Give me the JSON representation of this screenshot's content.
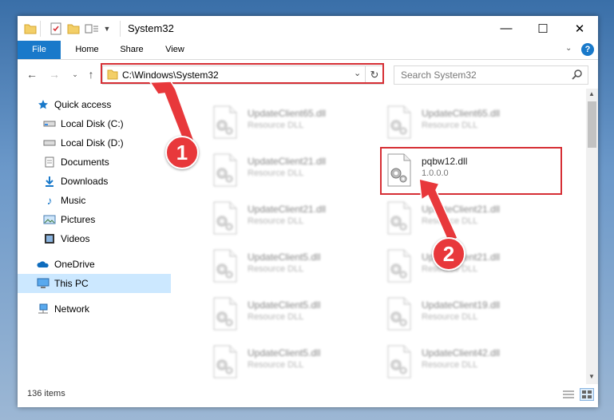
{
  "window": {
    "title": "System32"
  },
  "ribbon": {
    "tabs": [
      "File",
      "Home",
      "Share",
      "View"
    ]
  },
  "address": {
    "path": "C:\\Windows\\System32",
    "search_placeholder": "Search System32"
  },
  "sidebar": {
    "quick_access": "Quick access",
    "items": [
      {
        "label": "Local Disk (C:)",
        "icon": "drive-icon",
        "pinned": true
      },
      {
        "label": "Local Disk (D:)",
        "icon": "drive-icon",
        "pinned": true
      },
      {
        "label": "Documents",
        "icon": "documents-icon",
        "pinned": true
      },
      {
        "label": "Downloads",
        "icon": "downloads-icon",
        "pinned": true
      },
      {
        "label": "Music",
        "icon": "music-icon",
        "pinned": true
      },
      {
        "label": "Pictures",
        "icon": "pictures-icon",
        "pinned": true
      },
      {
        "label": "Videos",
        "icon": "videos-icon",
        "pinned": true
      }
    ],
    "onedrive": "OneDrive",
    "this_pc": "This PC",
    "network": "Network"
  },
  "files": {
    "col1": [
      {
        "name": "UpdateClient65.dll",
        "sub": "Resource DLL"
      },
      {
        "name": "UpdateClient21.dll",
        "sub": "Resource DLL"
      },
      {
        "name": "UpdateClient21.dll",
        "sub": "Resource DLL"
      },
      {
        "name": "UpdateClient5.dll",
        "sub": "Resource DLL"
      },
      {
        "name": "UpdateClient5.dll",
        "sub": "Resource DLL"
      },
      {
        "name": "UpdateClient5.dll",
        "sub": "Resource DLL"
      }
    ],
    "col2": [
      {
        "name": "UpdateClient65.dll",
        "sub": "Resource DLL"
      },
      {
        "name": "pqbw12.dll",
        "sub": "1.0.0.0"
      },
      {
        "name": "UpdateClient21.dll",
        "sub": "Resource DLL"
      },
      {
        "name": "UpdateClient21.dll",
        "sub": "Resource DLL"
      },
      {
        "name": "UpdateClient19.dll",
        "sub": "Resource DLL"
      },
      {
        "name": "UpdateClient42.dll",
        "sub": "Resource DLL"
      }
    ]
  },
  "status": {
    "count": "136 items"
  },
  "callouts": [
    "1",
    "2"
  ],
  "colors": {
    "accent": "#1979ca",
    "highlight": "#d62f35",
    "callout": "#e8383b",
    "selected": "#cce8ff"
  }
}
